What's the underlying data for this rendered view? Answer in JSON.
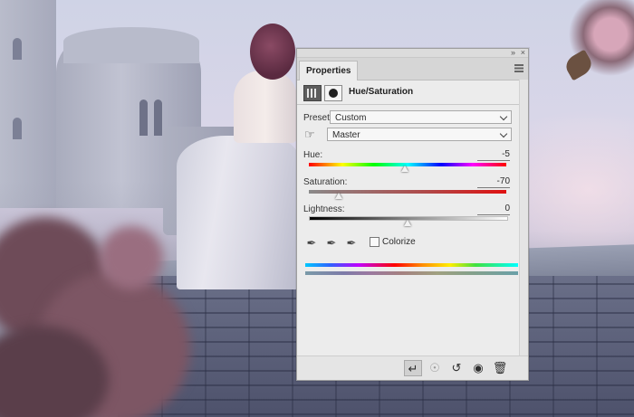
{
  "panel": {
    "tab_label": "Properties",
    "collapse_icon": "double-chevron-icon",
    "close_icon": "close-icon",
    "menu_icon": "panel-menu-icon",
    "adjustment_title": "Hue/Saturation",
    "preset_label": "Preset:",
    "preset_value": "Custom",
    "channel_value": "Master",
    "hue_label": "Hue:",
    "hue_value": "-5",
    "hue_level": -5,
    "saturation_label": "Saturation:",
    "saturation_value": "-70",
    "saturation_level": -70,
    "lightness_label": "Lightness:",
    "lightness_value": "0",
    "lightness_level": 0,
    "colorize_label": "Colorize",
    "colorize_checked": false
  },
  "bottom_bar": {
    "icons": [
      "clip-to-layer-icon",
      "view-previous-icon",
      "reset-icon",
      "visibility-eye-icon",
      "trash-icon"
    ]
  },
  "colors": {
    "panel_bg": "#ececec",
    "tab_bg": "#d6d6d6"
  }
}
